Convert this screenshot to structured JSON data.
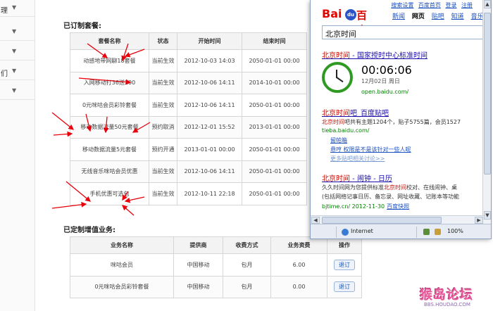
{
  "nav": {
    "rows": [
      {
        "label": "理",
        "arrow": "▼"
      },
      {
        "label": "",
        "arrow": "▼"
      },
      {
        "label": "",
        "arrow": "▼"
      },
      {
        "label": "们",
        "arrow": "▼"
      },
      {
        "label": "",
        "arrow": "▼"
      }
    ]
  },
  "packages": {
    "title": "已订制套餐:",
    "columns": [
      "套餐名称",
      "状态",
      "开始时间",
      "结束时间"
    ],
    "rows": [
      [
        "动感地带网聊18套餐",
        "当前生效",
        "2012-10-03 14:03",
        "2050-01-01 00:00"
      ],
      [
        "入网移动打36送200",
        "当前生效",
        "2012-10-06 14:11",
        "2014-10-01 00:00"
      ],
      [
        "0元咪咕会员彩铃套餐",
        "当前生效",
        "2012-10-06 14:11",
        "2050-01-01 00:00"
      ],
      [
        "移动数据流量50元套餐",
        "预约取消",
        "2012-12-01 15:52",
        "2013-01-01 00:00"
      ],
      [
        "移动数据流量5元套餐",
        "预约开通",
        "2013-01-01 00:00",
        "2050-01-01 00:00"
      ],
      [
        "无线音乐咪咕会员优惠",
        "当前生效",
        "2012-10-06 14:11",
        "2050-01-01 00:00"
      ],
      [
        "手机优惠可选包",
        "当前生效",
        "2012-10-11 22:18",
        "2050-01-01 00:00"
      ]
    ]
  },
  "services": {
    "title": "已定制增值业务:",
    "columns": [
      "业务名称",
      "提供商",
      "收费方式",
      "业务资费",
      "操作"
    ],
    "rows": [
      {
        "name": "咪咕会员",
        "provider": "中国移动",
        "billing": "包月",
        "fee": "6.00",
        "action": "退订"
      },
      {
        "name": "0元咪咕会员彩铃套餐",
        "provider": "中国移动",
        "billing": "包月",
        "fee": "0.00",
        "action": "退订"
      }
    ]
  },
  "popup": {
    "toplinks": [
      "搜索设置",
      "百度首页",
      "登录",
      "注册"
    ],
    "logo": {
      "left": "Bai",
      "right": "百度",
      "paw": "du"
    },
    "tabs": [
      "新闻",
      "网页",
      "贴吧",
      "知道",
      "音乐"
    ],
    "active_tab": "网页",
    "query": "北京时间",
    "r1": {
      "title_hl": "北京时间",
      "title_rest": " - 国家授时中心标准时间",
      "time": "00:06:06",
      "date": "12月02日  周日",
      "url": "open.baidu.com/"
    },
    "r2": {
      "title_hl": "北京时间",
      "title_rest": "吧_百度贴吧",
      "snip_hl": "北京时间",
      "snip_rest": "吧共有主题1204个，贴子5755篇，会员1527",
      "url": "tieba.baidu.com/",
      "links": [
        "留帕箱",
        "悬哼 权限是不是该针对一些人呢",
        "更多贴吧相关讨论>>"
      ]
    },
    "r3": {
      "title_hl": "北京时间",
      "title_rest": " - 闹钟 - 日历",
      "snip1_a": "久久时间网为您提供标准",
      "snip1_hl": "北京时间",
      "snip1_b": "校对、在线闹钟、桌",
      "snip2": "(包括网络记事日历、备忘录、网址收藏、记账本等功能",
      "url": "bjtime.cn/ 2012-11-30",
      "snapshot": "百度快照"
    },
    "status": {
      "zone": "Internet",
      "zoom": "100%"
    }
  },
  "watermark": {
    "big": "猴岛论坛",
    "small": "BBS.HOUDAO.COM"
  },
  "colors": {
    "arrow": "#e8000b",
    "baidu_red": "#e10602",
    "baidu_blue": "#2d54c6",
    "link": "#1a0dab"
  }
}
